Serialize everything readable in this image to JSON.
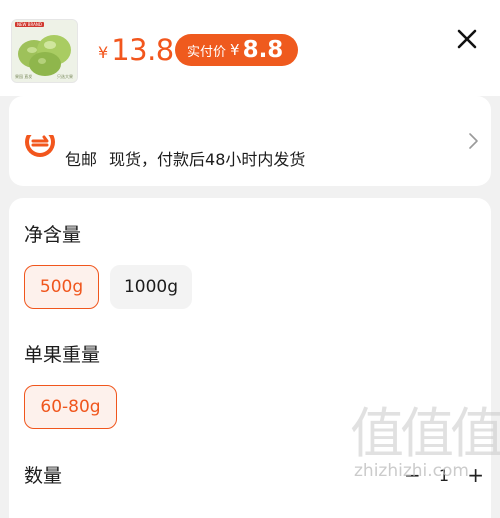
{
  "header": {
    "thumbnail": {
      "tag": "NEW BRAND",
      "caption_left": "果园\n直发",
      "caption_right": "只选大果"
    },
    "price": {
      "currency": "¥",
      "amount": "13.8"
    },
    "actual_pay": {
      "label": "实付价",
      "currency": "¥",
      "amount": "8.8"
    },
    "close_icon": "close-icon"
  },
  "shipping": {
    "icon": "delivery-icon",
    "obscured_line": "",
    "free_shipping": "包邮",
    "stock": "现货，付款后48小时内发货",
    "chevron": "chevron-right-icon"
  },
  "specs": {
    "groups": [
      {
        "title": "净含量",
        "options": [
          "500g",
          "1000g"
        ],
        "selected": "500g"
      },
      {
        "title": "单果重量",
        "options": [
          "60-80g"
        ],
        "selected": "60-80g"
      }
    ],
    "quantity": {
      "title": "数量",
      "value": "1"
    }
  },
  "watermark": {
    "glyphs": "值值值",
    "url": "zhizhizhi.com"
  },
  "colors": {
    "accent": "#f2561d",
    "accent_bg": "#fdf1ec",
    "page_bg": "#f1f1f1"
  }
}
